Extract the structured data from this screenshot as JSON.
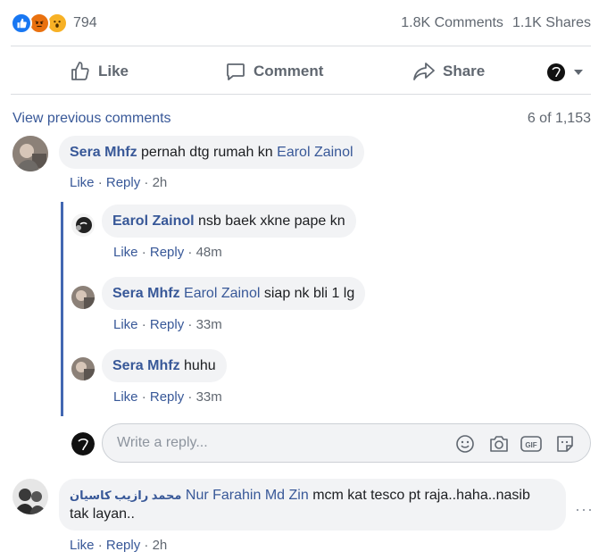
{
  "post_stats": {
    "reactions_count": "794",
    "reaction_types": [
      "like-icon",
      "angry-icon",
      "wow-icon"
    ],
    "comments": "1.8K Comments",
    "shares": "1.1K Shares"
  },
  "actions": {
    "like": "Like",
    "comment": "Comment",
    "share": "Share"
  },
  "comments_header": {
    "view_previous": "View previous comments",
    "page": "6 of 1,153"
  },
  "comments": [
    {
      "author": "Sera Mhfz",
      "text": "pernah dtg rumah kn",
      "mention": "Earol Zainol",
      "like": "Like",
      "reply": "Reply",
      "time": "2h",
      "replies": [
        {
          "author": "Earol Zainol",
          "mention": "",
          "text": "nsb baek xkne pape kn",
          "like": "Like",
          "reply": "Reply",
          "time": "48m"
        },
        {
          "author": "Sera Mhfz",
          "mention": "Earol Zainol",
          "text": "siap nk bli 1 lg",
          "like": "Like",
          "reply": "Reply",
          "time": "33m"
        },
        {
          "author": "Sera Mhfz",
          "mention": "",
          "text": "huhu",
          "like": "Like",
          "reply": "Reply",
          "time": "33m"
        }
      ]
    },
    {
      "author": "محمد رازيب كاسيان",
      "mention": "Nur Farahin Md Zin",
      "text_line1": "mcm kat tesco pt raja..haha..nasib",
      "text_line2": "tak layan..",
      "like": "Like",
      "reply": "Reply",
      "time": "2h"
    }
  ],
  "reply_box": {
    "placeholder": "Write a reply...",
    "tools": [
      "emoji-icon",
      "camera-icon",
      "gif-icon",
      "sticker-icon"
    ]
  },
  "separator": "·",
  "colors": {
    "link": "#385898",
    "thread_line": "#4267b2",
    "bubble": "#f2f3f5",
    "muted": "#606770"
  }
}
